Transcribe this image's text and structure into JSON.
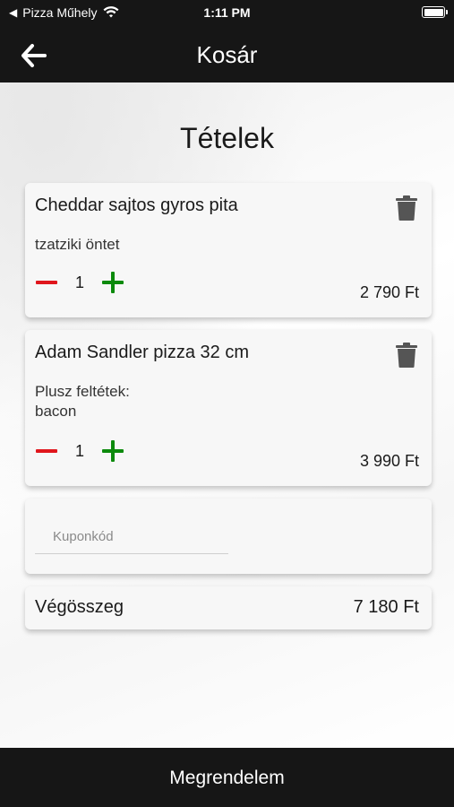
{
  "status_bar": {
    "carrier": "Pizza Műhely",
    "time": "1:11 PM"
  },
  "header": {
    "title": "Kosár"
  },
  "section": {
    "title": "Tételek"
  },
  "items": [
    {
      "name": "Cheddar sajtos gyros pita",
      "description_lines": [
        "tzatziki öntet"
      ],
      "quantity": "1",
      "price": "2 790 Ft"
    },
    {
      "name": "Adam Sandler pizza 32 cm",
      "description_lines": [
        "Plusz feltétek:",
        "bacon"
      ],
      "quantity": "1",
      "price": "3 990 Ft"
    }
  ],
  "coupon": {
    "placeholder": "Kuponkód",
    "value": ""
  },
  "total": {
    "label": "Végösszeg",
    "value": "7 180 Ft"
  },
  "footer": {
    "order_button_label": "Megrendelem"
  },
  "colors": {
    "bar_background": "#161616",
    "minus": "#e0161c",
    "plus": "#0c8a0c",
    "trash": "#555555"
  },
  "icons": {
    "back": "back-arrow-icon",
    "delete": "trash-icon",
    "decrease": "minus-icon",
    "increase": "plus-icon",
    "wifi": "wifi-icon",
    "battery": "battery-icon"
  }
}
